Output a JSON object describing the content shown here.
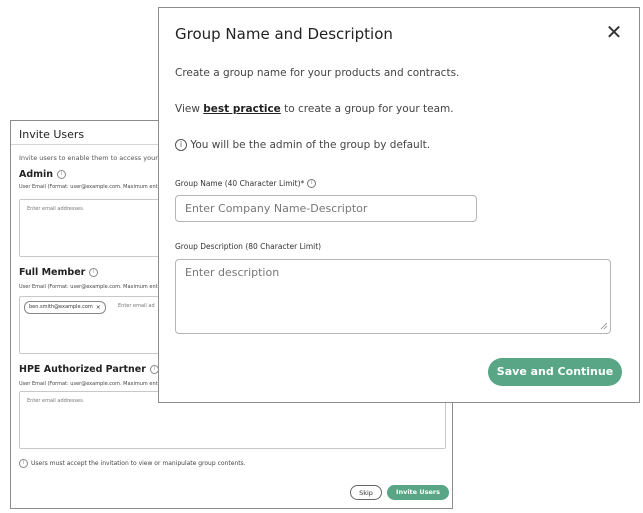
{
  "invite": {
    "title": "Invite Users",
    "description": "Invite users to enable them to access your g",
    "sections": [
      {
        "title": "Admin",
        "hint": "User Email (Format: user@example.com. Maximum ent",
        "placeholder": "Enter email addresses."
      },
      {
        "title": "Full Member",
        "hint": "User Email (Format: user@example.com. Maximum ent",
        "chip": "ben.smith@example.com",
        "chip_close": "×",
        "placeholder": "Enter email ad"
      },
      {
        "title": "HPE Authorized Partner",
        "hint": "User Email (Format: user@example.com. Maximum ent",
        "placeholder": "Enter email addresses."
      }
    ],
    "footer_note": "Users must accept the invitation to view or manipulate group contents.",
    "skip_label": "Skip",
    "invite_label": "Invite Users"
  },
  "modal": {
    "title": "Group Name and Description",
    "close_symbol": "✕",
    "intro": "Create a group name for your products and contracts.",
    "view_prefix": "View ",
    "best_practice_link": "best practice",
    "view_suffix": " to create a group for your team.",
    "admin_note": "You will be the admin of the group by default.",
    "name_label": "Group Name (40 Character Limit)",
    "required_mark": "*",
    "name_placeholder": "Enter Company Name-Descriptor",
    "desc_label": "Group Description (80 Character Limit)",
    "desc_placeholder": "Enter description",
    "save_label": "Save and Continue"
  },
  "colors": {
    "accent_green": "#58a685",
    "border_gray": "#8c8c8c"
  },
  "icons": {
    "info": "info-icon",
    "close": "close-icon"
  }
}
